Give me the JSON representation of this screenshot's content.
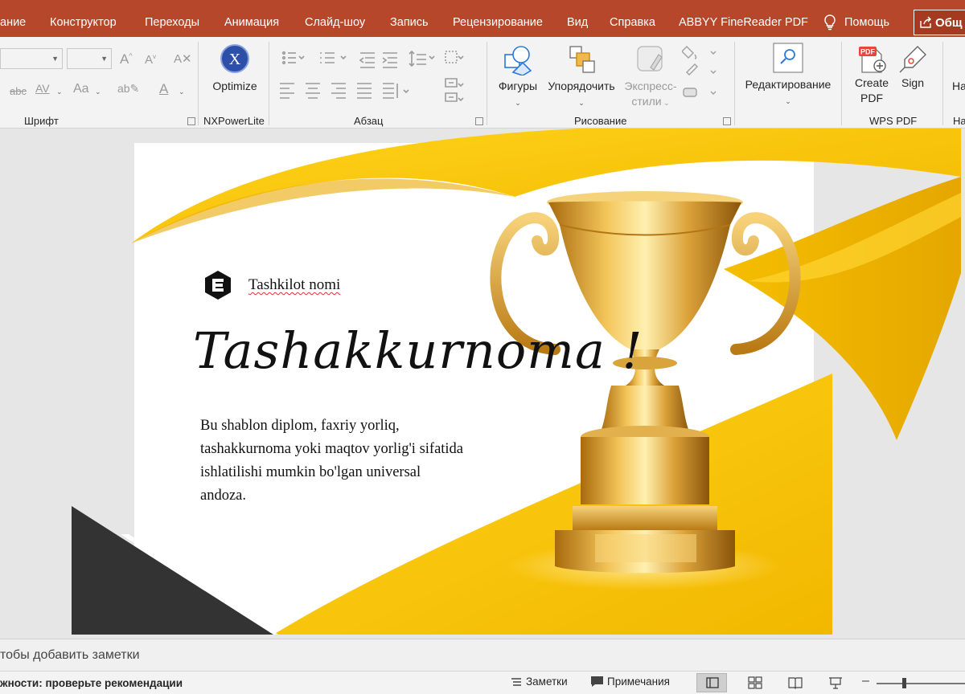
{
  "tabs": [
    "ание",
    "Конструктор",
    "Переходы",
    "Анимация",
    "Слайд-шоу",
    "Запись",
    "Рецензирование",
    "Вид",
    "Справка",
    "ABBYY FineReader PDF"
  ],
  "help": "Помощь",
  "share": "Общ",
  "ribbon": {
    "font_group": "Шрифт",
    "nxpower_group": "NXPowerLite",
    "optimize": "Optimize",
    "paragraph_group": "Абзац",
    "drawing_group": "Рисование",
    "shapes": "Фигуры",
    "arrange": "Упорядочить",
    "quick_styles_1": "Экспресс-",
    "quick_styles_2": "стили",
    "editing": "Редактирование",
    "wps_group": "WPS PDF",
    "create_pdf_1": "Create",
    "create_pdf_2": "PDF",
    "sign": "Sign",
    "cut_button": "На",
    "cut_group": "На",
    "pdf_badge": "PDF",
    "change_case": "Aa",
    "strikethrough": "abc",
    "spacing": "AV"
  },
  "slide": {
    "logo_letter": "E",
    "org_name": "Tashkilot nomi",
    "title": "Tashakkurnoma !",
    "body_lines": [
      "Bu shablon diplom, faxriy yorliq,",
      "tashakkurnoma yoki maqtov yorlig'i sifatida",
      "ishlatilishi mumkin bo'lgan universal",
      "andoza."
    ]
  },
  "notes_placeholder": "тобы добавить заметки",
  "status": {
    "accessibility": "жности: проверьте рекомендации",
    "notes": "Заметки",
    "comments": "Примечания"
  },
  "colors": {
    "accent": "#b7472a",
    "gold": "#f6c200",
    "dark": "#333333"
  }
}
